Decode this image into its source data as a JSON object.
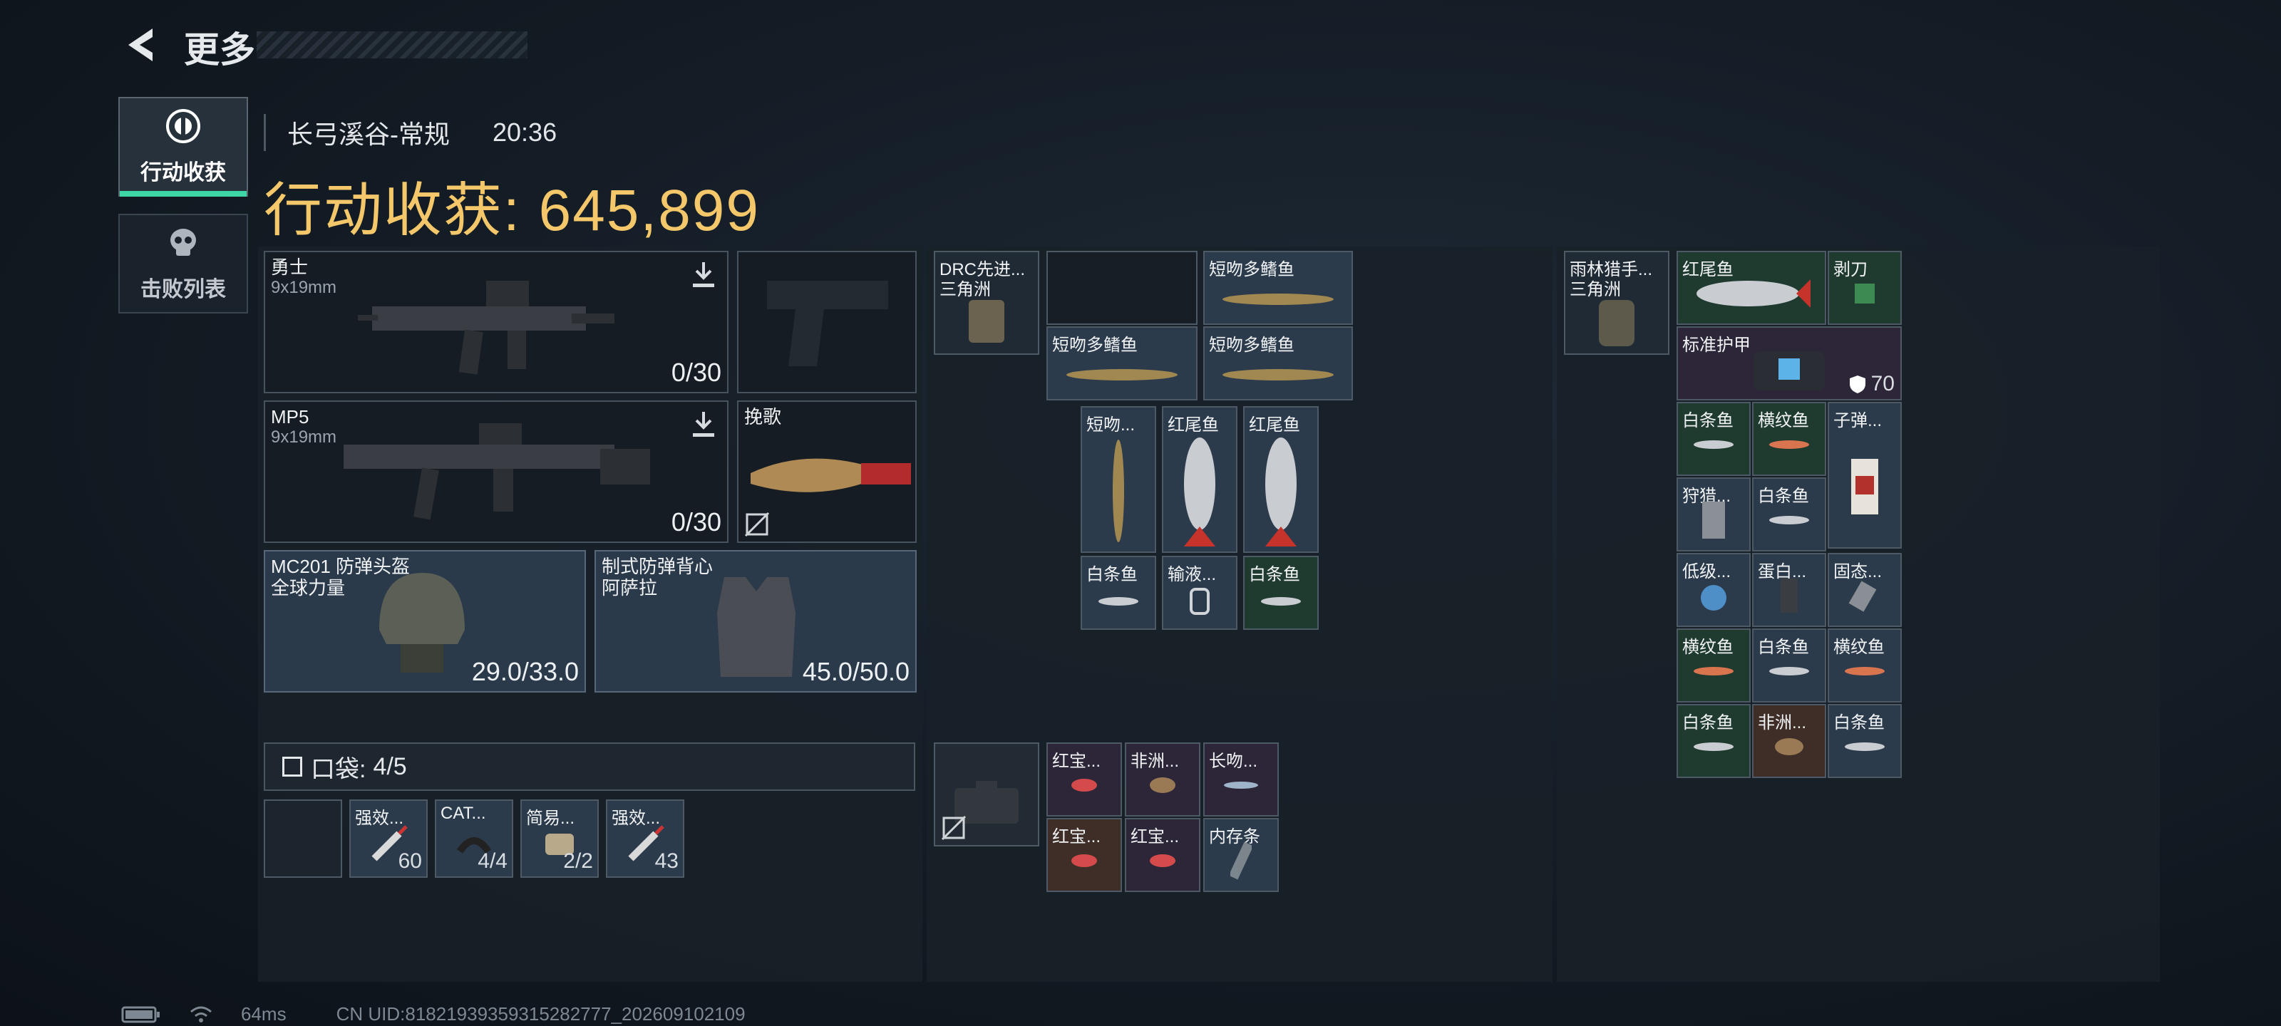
{
  "header": {
    "title": "更多"
  },
  "sidebar": {
    "items": [
      {
        "label": "行动收获",
        "active": true
      },
      {
        "label": "击败列表",
        "active": false
      }
    ]
  },
  "match": {
    "map": "长弓溪谷-常规",
    "time": "20:36"
  },
  "harvest": {
    "label": "行动收获:",
    "value": "645,899"
  },
  "loadout": {
    "primary": {
      "name": "勇士",
      "ammo_type": "9x19mm",
      "ammo": "0/30"
    },
    "secondary": {
      "name": "MP5",
      "ammo_type": "9x19mm",
      "ammo": "0/30"
    },
    "melee": {
      "name": "挽歌"
    },
    "helmet": {
      "name": "MC201 防弹头盔",
      "sub": "全球力量",
      "durability": "29.0/33.0"
    },
    "armor": {
      "name": "制式防弹背心",
      "sub": "阿萨拉",
      "durability": "45.0/50.0"
    }
  },
  "pocket": {
    "label": "口袋:",
    "count": "4/5",
    "items": [
      {
        "name": "",
        "count": ""
      },
      {
        "name": "强效...",
        "count": "60"
      },
      {
        "name": "CAT...",
        "count": "4/4"
      },
      {
        "name": "简易...",
        "count": "2/2"
      },
      {
        "name": "强效...",
        "count": "43"
      }
    ]
  },
  "chest_rig": {
    "name": "DRC先进...",
    "sub": "三角洲",
    "items": [
      {
        "name": ""
      },
      {
        "name": "短吻多鳍鱼"
      },
      {
        "name": "短吻多鳍鱼"
      },
      {
        "name": "短吻多鳍鱼"
      },
      {
        "name": "短吻..."
      },
      {
        "name": "红尾鱼"
      },
      {
        "name": "红尾鱼"
      },
      {
        "name": "白条鱼"
      },
      {
        "name": "输液..."
      },
      {
        "name": "白条鱼"
      }
    ]
  },
  "case": {
    "items": [
      {
        "name": "红宝..."
      },
      {
        "name": "非洲..."
      },
      {
        "name": "长吻..."
      },
      {
        "name": "红宝..."
      },
      {
        "name": "红宝..."
      },
      {
        "name": "内存条"
      }
    ]
  },
  "backpack": {
    "name": "雨林猎手...",
    "sub": "三角洲",
    "items": [
      {
        "name": "红尾鱼"
      },
      {
        "name": "剥刀"
      },
      {
        "name": "标准护甲",
        "count": "70"
      },
      {
        "name": "白条鱼"
      },
      {
        "name": "横纹鱼"
      },
      {
        "name": "子弹..."
      },
      {
        "name": "狩猎..."
      },
      {
        "name": "白条鱼"
      },
      {
        "name": "低级..."
      },
      {
        "name": "蛋白..."
      },
      {
        "name": "固态..."
      },
      {
        "name": "横纹鱼"
      },
      {
        "name": "白条鱼"
      },
      {
        "name": "横纹鱼"
      },
      {
        "name": "白条鱼"
      },
      {
        "name": "非洲..."
      },
      {
        "name": "白条鱼"
      }
    ]
  },
  "status": {
    "ping": "64ms",
    "uid": "CN UID:81821939359315282777_202609102109"
  },
  "colors": {
    "accent": "#f3c76a",
    "active_bar": "#3fd6a6"
  }
}
